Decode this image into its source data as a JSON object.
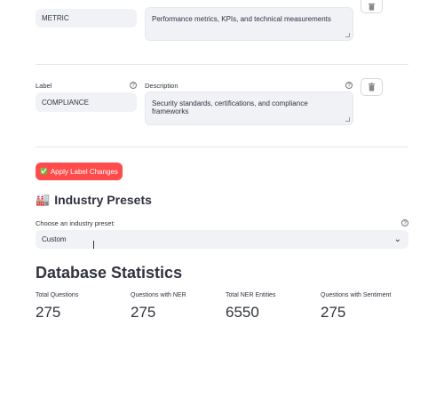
{
  "row1": {
    "label_value": "METRIC",
    "description_value": "Performance metrics, KPIs, and technical measurements"
  },
  "row2": {
    "label_caption": "Label",
    "label_value": "COMPLIANCE",
    "description_caption": "Description",
    "description_value": "Security standards, certifications, and compliance frameworks"
  },
  "help_glyph": "?",
  "apply_button": {
    "icon": "✅",
    "label": "Apply Label Changes",
    "color": "#ff4b4b"
  },
  "industry": {
    "icon": "🏭",
    "heading": "Industry Presets",
    "select_caption": "Choose an industry preset:",
    "selected": "Custom",
    "chevron": "⌄"
  },
  "stats": {
    "heading": "Database Statistics",
    "items": [
      {
        "label": "Total Questions",
        "value": "275"
      },
      {
        "label": "Questions with NER",
        "value": "275"
      },
      {
        "label": "Total NER Entities",
        "value": "6550"
      },
      {
        "label": "Questions with Sentiment",
        "value": "275"
      }
    ]
  }
}
